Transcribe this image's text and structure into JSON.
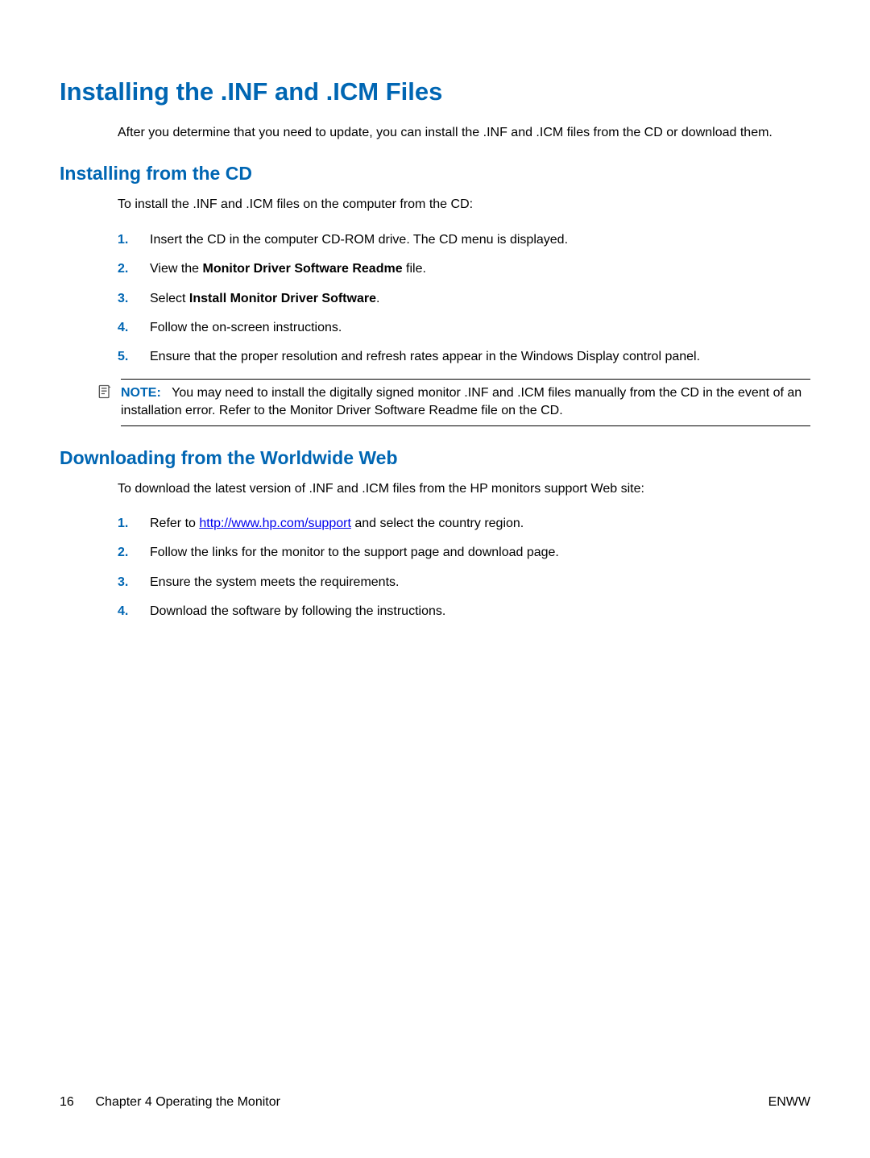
{
  "h1": "Installing the .INF and .ICM Files",
  "intro": "After you determine that you need to update, you can install the .INF and .ICM files from the CD or download them.",
  "section1": {
    "heading": "Installing from the CD",
    "lead": "To install the .INF and .ICM files on the computer from the CD:",
    "items": {
      "n1": "1.",
      "t1": "Insert the CD in the computer CD-ROM drive. The CD menu is displayed.",
      "n2": "2.",
      "t2a": "View the ",
      "t2b": "Monitor Driver Software Readme",
      "t2c": " file.",
      "n3": "3.",
      "t3a": "Select ",
      "t3b": "Install Monitor Driver Software",
      "t3c": ".",
      "n4": "4.",
      "t4": "Follow the on-screen instructions.",
      "n5": "5.",
      "t5": "Ensure that the proper resolution and refresh rates appear in the Windows Display control panel."
    },
    "note_label": "NOTE:",
    "note_text": "You may need to install the digitally signed monitor .INF and .ICM files manually from the CD in the event of an installation error. Refer to the Monitor Driver Software Readme file on the CD."
  },
  "section2": {
    "heading": "Downloading from the Worldwide Web",
    "lead": "To download the latest version of .INF and .ICM files from the HP monitors support Web site:",
    "items": {
      "n1": "1.",
      "t1a": "Refer to ",
      "link": "http://www.hp.com/support",
      "t1b": " and select the country region.",
      "n2": "2.",
      "t2": "Follow the links for the monitor to the support page and download page.",
      "n3": "3.",
      "t3": "Ensure the system meets the requirements.",
      "n4": "4.",
      "t4": "Download the software by following the instructions."
    }
  },
  "footer": {
    "page_num": "16",
    "chapter": "Chapter 4   Operating the Monitor",
    "right": "ENWW"
  }
}
